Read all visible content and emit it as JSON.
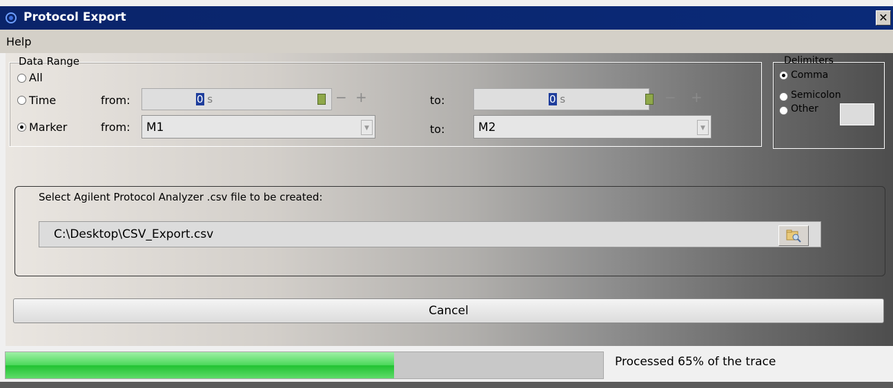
{
  "window": {
    "title": "Protocol Export",
    "close_label": "✕"
  },
  "menu": {
    "items": [
      "Help"
    ]
  },
  "data_range": {
    "legend": "Data Range",
    "options": [
      "All",
      "Time",
      "Marker"
    ],
    "selected": "Marker",
    "from_label": "from:",
    "to_label": "to:",
    "time_from": {
      "cursor": "0",
      "unit": "s"
    },
    "time_to": {
      "cursor": "0",
      "unit": "s"
    },
    "marker_from": "M1",
    "marker_to": "M2"
  },
  "delimiters": {
    "legend": "Delimiters",
    "options": [
      "Comma",
      "Semicolon",
      "Other"
    ],
    "selected": "Comma",
    "other_value": ""
  },
  "file": {
    "prompt": "Select Agilent Protocol Analyzer .csv file to be created:",
    "path": "C:\\Desktop\\CSV_Export.csv"
  },
  "cancel_label": "Cancel",
  "status": {
    "progress": 0.65,
    "text": "Processed 65% of the trace"
  }
}
